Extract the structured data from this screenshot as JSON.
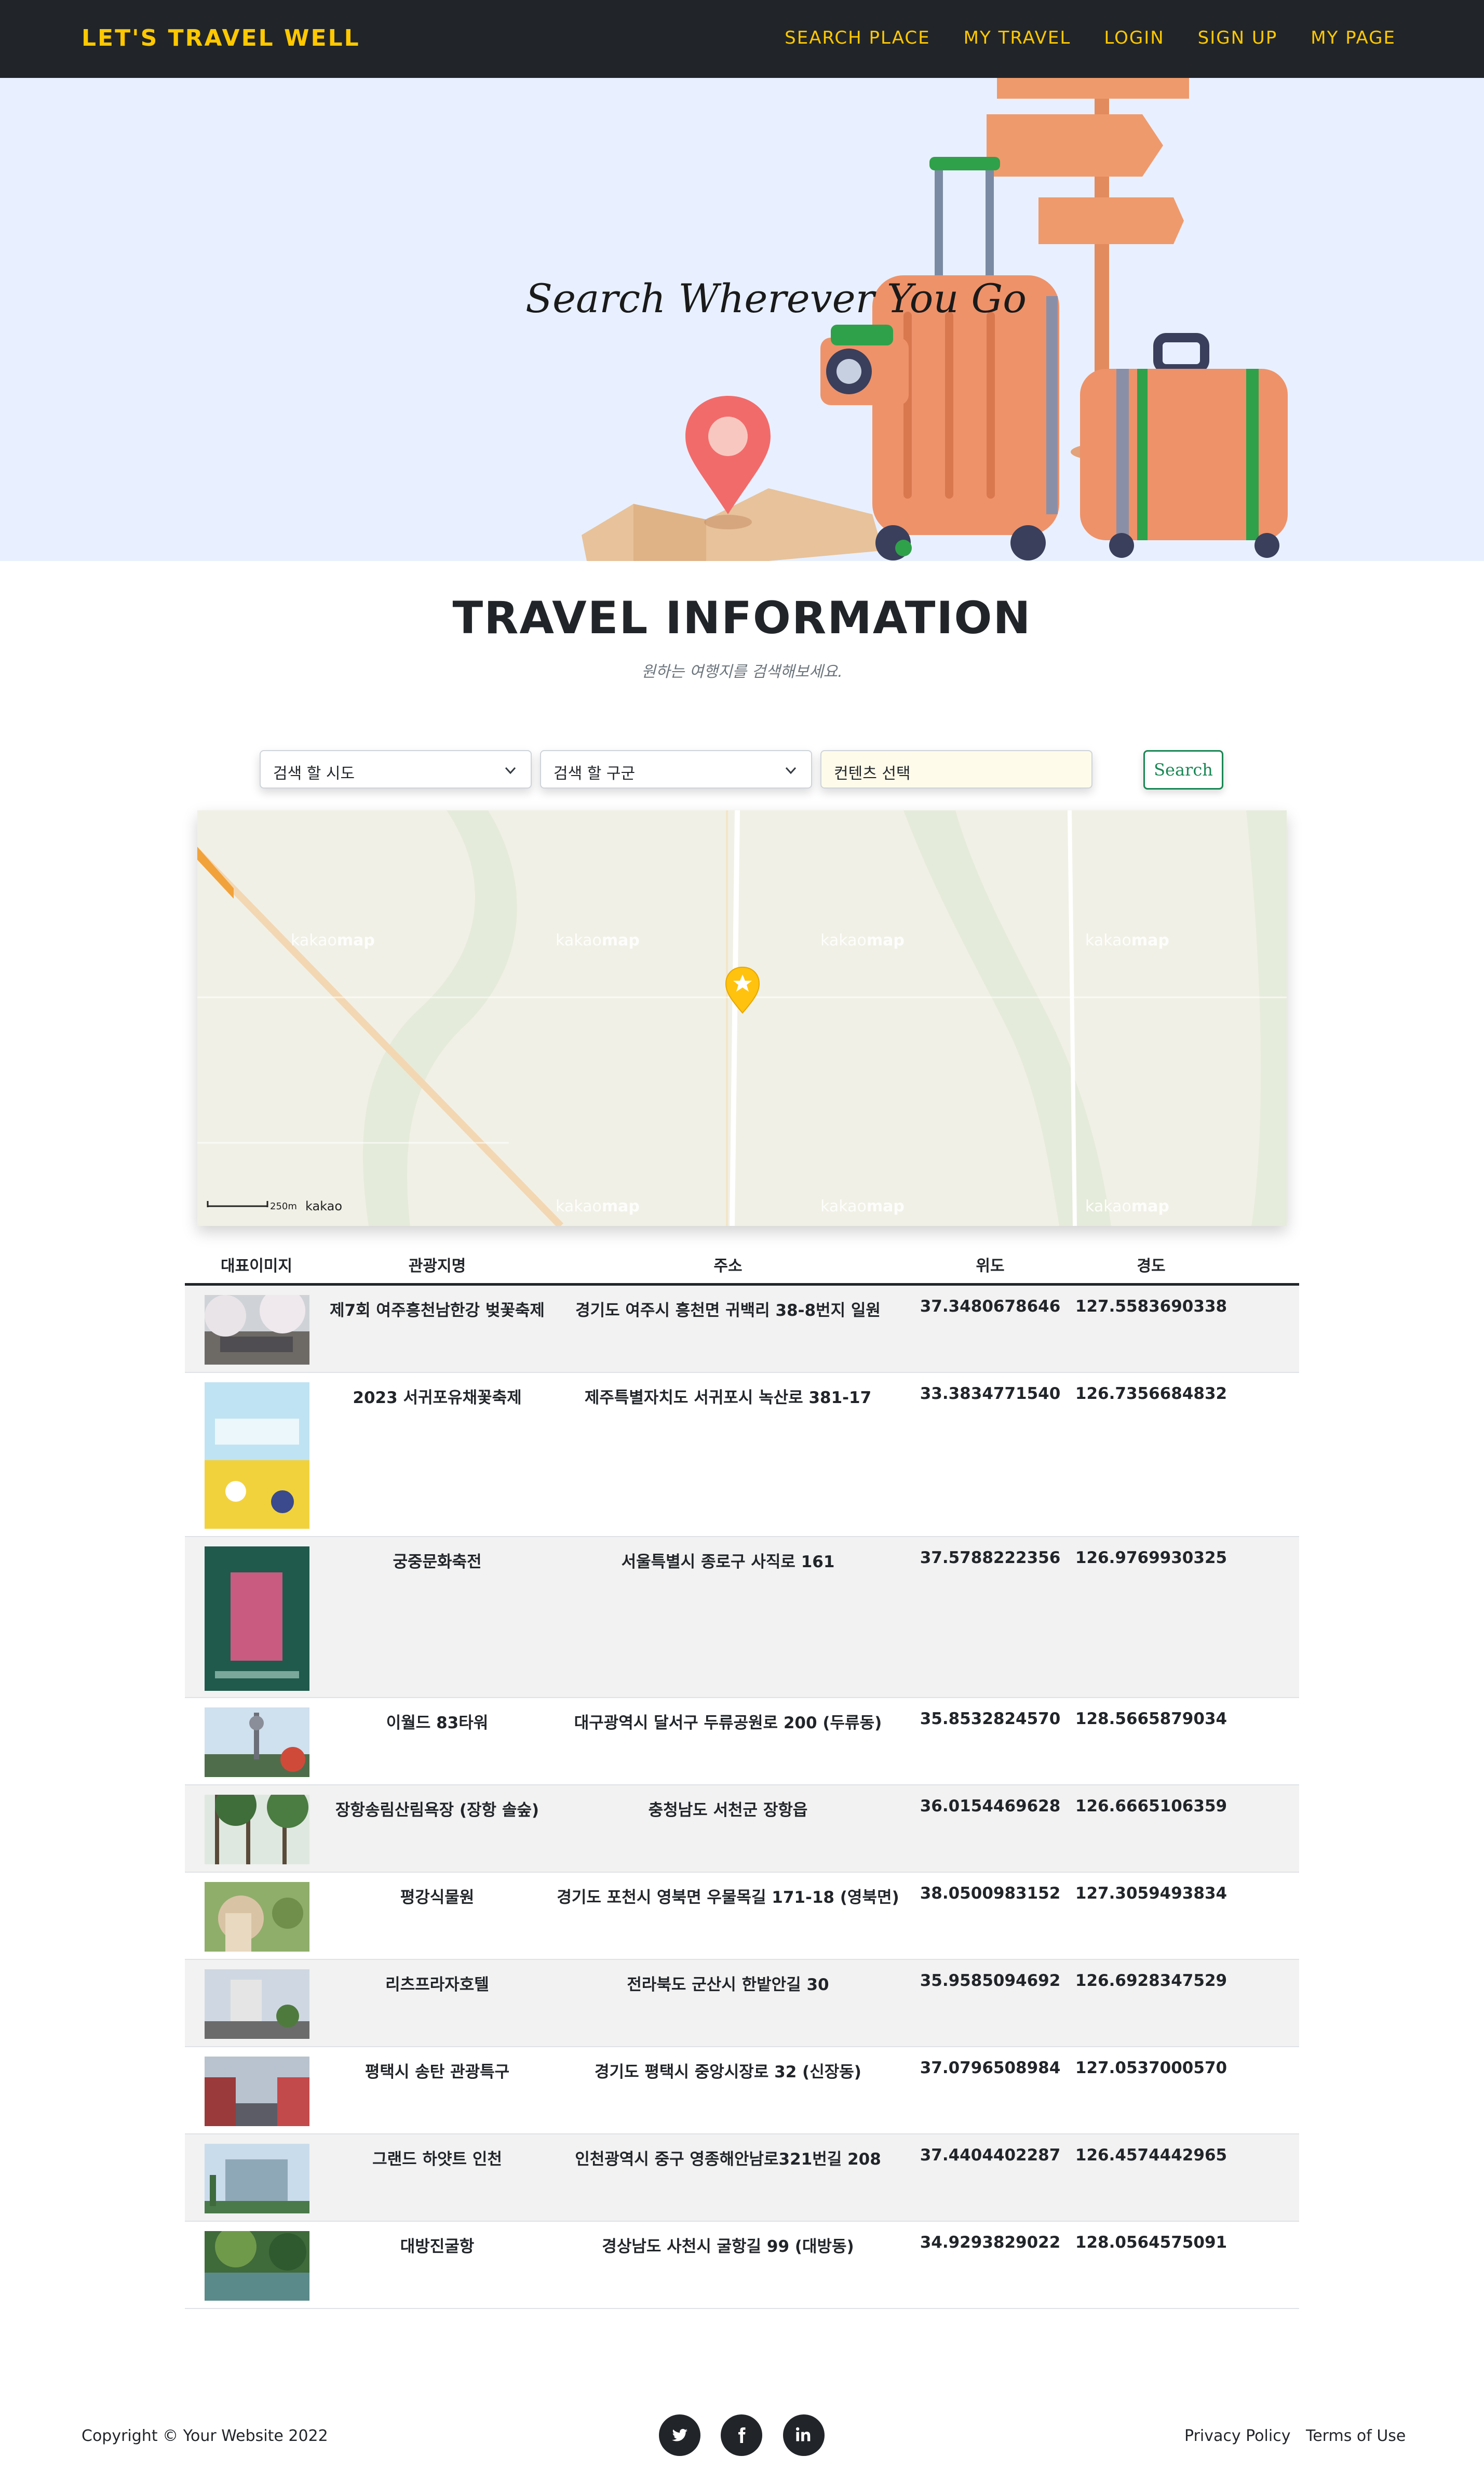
{
  "nav": {
    "brand": "LET'S TRAVEL WELL",
    "links": [
      "SEARCH PLACE",
      "MY TRAVEL",
      "LOGIN",
      "SIGN UP",
      "MY PAGE"
    ]
  },
  "hero": {
    "title": "Search Wherever You Go"
  },
  "section": {
    "title": "TRAVEL INFORMATION",
    "subtitle": "원하는 여행지를 검색해보세요."
  },
  "filters": {
    "sido": "검색 할 시도",
    "gugun": "검색 할 구군",
    "content": "컨텐츠 선택",
    "search_label": "Search"
  },
  "map": {
    "watermark": "kakaomap",
    "scale_label": "250m",
    "brand": "kakao"
  },
  "table": {
    "headers": [
      "대표이미지",
      "관광지명",
      "주소",
      "위도",
      "경도"
    ],
    "rows": [
      {
        "name": "제7회 여주흥천남한강 벚꽃축제",
        "address": "경기도 여주시 흥천면 귀백리 38-8번지 일원",
        "lat": "37.3480678646",
        "lng": "127.5583690338"
      },
      {
        "name": "2023 서귀포유채꽃축제",
        "address": "제주특별자치도 서귀포시 녹산로 381-17",
        "lat": "33.3834771540",
        "lng": "126.7356684832"
      },
      {
        "name": "궁중문화축전",
        "address": "서울특별시 종로구 사직로 161",
        "lat": "37.5788222356",
        "lng": "126.9769930325"
      },
      {
        "name": "이월드 83타워",
        "address": "대구광역시 달서구 두류공원로 200 (두류동)",
        "lat": "35.8532824570",
        "lng": "128.5665879034"
      },
      {
        "name": "장항송림산림욕장 (장항 솔숲)",
        "address": "충청남도 서천군 장항읍",
        "lat": "36.0154469628",
        "lng": "126.6665106359"
      },
      {
        "name": "평강식물원",
        "address": "경기도 포천시 영북면 우물목길 171-18 (영북면)",
        "lat": "38.0500983152",
        "lng": "127.3059493834"
      },
      {
        "name": "리츠프라자호텔",
        "address": "전라북도 군산시 한밭안길 30",
        "lat": "35.9585094692",
        "lng": "126.6928347529"
      },
      {
        "name": "평택시 송탄 관광특구",
        "address": "경기도 평택시 중앙시장로 32 (신장동)",
        "lat": "37.0796508984",
        "lng": "127.0537000570"
      },
      {
        "name": "그랜드 하얏트 인천",
        "address": "인천광역시 중구 영종해안남로321번길 208",
        "lat": "37.4404402287",
        "lng": "126.4574442965"
      },
      {
        "name": "대방진굴항",
        "address": "경상남도 사천시 굴항길 99 (대방동)",
        "lat": "34.9293829022",
        "lng": "128.0564575091"
      }
    ]
  },
  "footer": {
    "copyright": "Copyright © Your Website 2022",
    "social": [
      "twitter-icon",
      "facebook-icon",
      "linkedin-icon"
    ],
    "privacy": "Privacy Policy",
    "terms": "Terms of Use"
  },
  "colors": {
    "accent": "#ffc800",
    "dark": "#212529",
    "success": "#198754",
    "hero_bg": "#e8f0ff"
  }
}
